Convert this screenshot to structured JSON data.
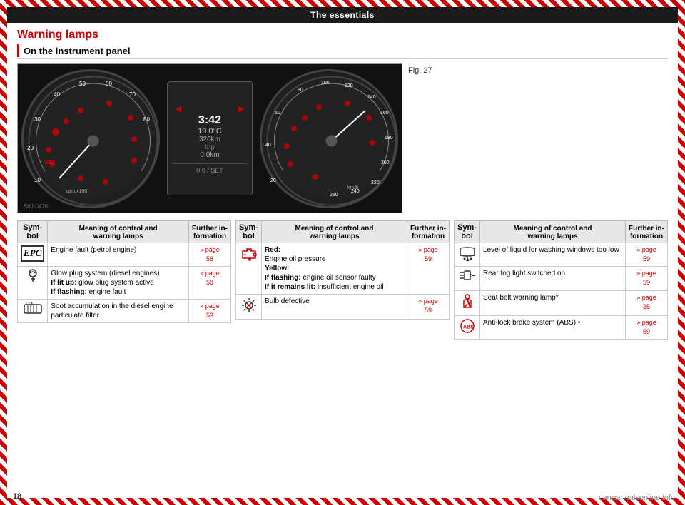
{
  "page": {
    "number": "18",
    "watermark": "carmanualsonline.info"
  },
  "header": {
    "title": "The essentials"
  },
  "main_title": "Warning lamps",
  "section_title": "On the instrument panel",
  "figure": {
    "label": "Fig. 27",
    "code": "S6J-0476",
    "display_text": "0.0 / SET",
    "time": "3:42",
    "temp": "19.0°C",
    "odo": "320km",
    "trip": "0.0km"
  },
  "table1": {
    "headers": [
      "Sym-\nbol",
      "Meaning of control and\nwarning lamps",
      "Further in-\nformation"
    ],
    "rows": [
      {
        "symbol": "EPC",
        "symbol_type": "epc",
        "meaning": "Engine fault (petrol engine)",
        "further": "»» page\n58"
      },
      {
        "symbol": "glow",
        "symbol_type": "glow",
        "meaning": "Glow plug system (diesel engines)\nIf lit up: glow plug system active\nIf flashing: engine fault",
        "further": "»» page\n58"
      },
      {
        "symbol": "soot",
        "symbol_type": "soot",
        "meaning": "Soot accumulation in the diesel engine particulate filter",
        "further": "»» page\n59"
      }
    ]
  },
  "table2": {
    "headers": [
      "Sym-\nbol",
      "Meaning of control and\nwarning lamps",
      "Further in-\nformation"
    ],
    "rows": [
      {
        "symbol": "oil_pressure",
        "symbol_type": "oil",
        "meaning_parts": [
          {
            "text": "Red:",
            "bold": true
          },
          {
            "text": "\nEngine oil pressure",
            "bold": false
          },
          {
            "text": "\nYellow:",
            "bold": true
          },
          {
            "text": "\nIf flashing: ",
            "bold": false,
            "italic": true
          },
          {
            "text": "engine oil sensor faulty",
            "bold": false
          },
          {
            "text": "\nIf it remains lit: ",
            "bold": false,
            "italic": true
          },
          {
            "text": "insufficient engine oil",
            "bold": false
          }
        ],
        "further": "»» page\n59"
      },
      {
        "symbol": "bulb",
        "symbol_type": "bulb",
        "meaning": "Bulb defective",
        "further": "»» page\n59"
      }
    ]
  },
  "table3": {
    "headers": [
      "Sym-\nbol",
      "Meaning of control and\nwarning lamps",
      "Further in-\nformation"
    ],
    "rows": [
      {
        "symbol": "washer",
        "symbol_type": "washer",
        "meaning": "Level of liquid for washing windows too low",
        "further": "»» page\n59"
      },
      {
        "symbol": "fog",
        "symbol_type": "fog",
        "meaning": "Rear fog light switched on",
        "further": "»» page\n59"
      },
      {
        "symbol": "seatbelt",
        "symbol_type": "seatbelt",
        "meaning": "Seat belt warning lamp*",
        "further": "»» page\n35"
      },
      {
        "symbol": "abs",
        "symbol_type": "abs",
        "meaning": "Anti-lock brake system (ABS) •",
        "further": "»» page\n59"
      }
    ]
  }
}
